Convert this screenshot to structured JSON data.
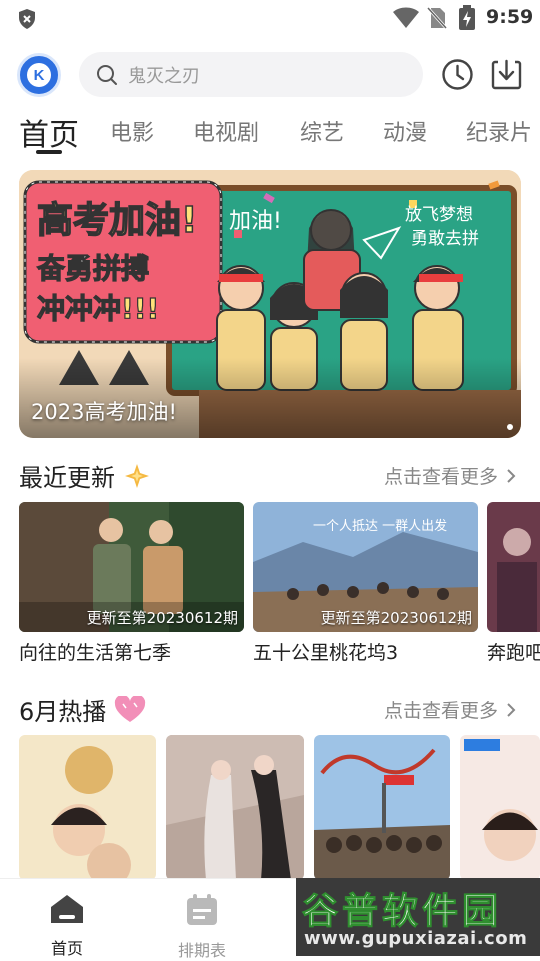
{
  "status_bar": {
    "time": "9:59"
  },
  "search": {
    "placeholder": "鬼灭之刃"
  },
  "tabs": [
    {
      "label": "首页",
      "active": true
    },
    {
      "label": "电影"
    },
    {
      "label": "电视剧"
    },
    {
      "label": "综艺"
    },
    {
      "label": "动漫"
    },
    {
      "label": "纪录片"
    }
  ],
  "banner": {
    "caption": "2023高考加油!",
    "artwork_text": {
      "line1": "高考加油!",
      "line2": "奋勇拼搏",
      "line3": "冲冲冲!!!",
      "board1": "加油!",
      "board2": "放飞梦想",
      "board3": "勇敢去拼"
    }
  },
  "recent": {
    "title": "最近更新",
    "more": "点击查看更多",
    "items": [
      {
        "badge": "更新至第20230612期",
        "title": "向往的生活第七季"
      },
      {
        "badge": "更新至第20230612期",
        "title": "五十公里桃花坞3",
        "overlay_text": "一个人抵达 一群人出发"
      },
      {
        "badge": "",
        "title": "奔跑吧"
      }
    ]
  },
  "hot": {
    "title": "6月热播",
    "more": "点击查看更多"
  },
  "bottom_nav": [
    {
      "label": "首页",
      "active": true
    },
    {
      "label": "排期表"
    }
  ],
  "watermark": {
    "text": "谷普软件园",
    "url": "www.gupuxiazai.com"
  },
  "colors": {
    "accent": "#2d6fe0",
    "active_text": "#222222",
    "inactive_text": "#888888"
  }
}
